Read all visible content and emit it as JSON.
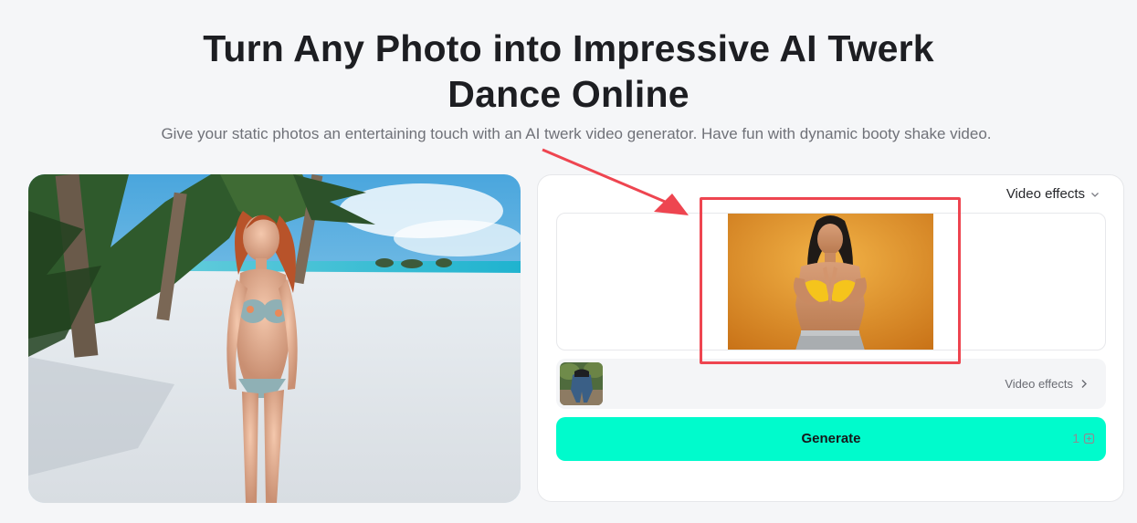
{
  "hero": {
    "title_line1": "Turn Any Photo into Impressive AI Twerk",
    "title_line2": "Dance Online",
    "subtitle": "Give your static photos an entertaining touch with an AI twerk video generator. Have fun with dynamic booty shake video."
  },
  "panel": {
    "dropdown_label": "Video effects",
    "effect_link_label": "Video effects",
    "generate_label": "Generate",
    "credit_cost": "1"
  },
  "colors": {
    "accent": "#00fbcc",
    "annotation": "#ee4550",
    "background": "#f5f6f8"
  },
  "icons": [
    "chevron-down-icon",
    "chevron-right-icon",
    "credit-icon"
  ]
}
